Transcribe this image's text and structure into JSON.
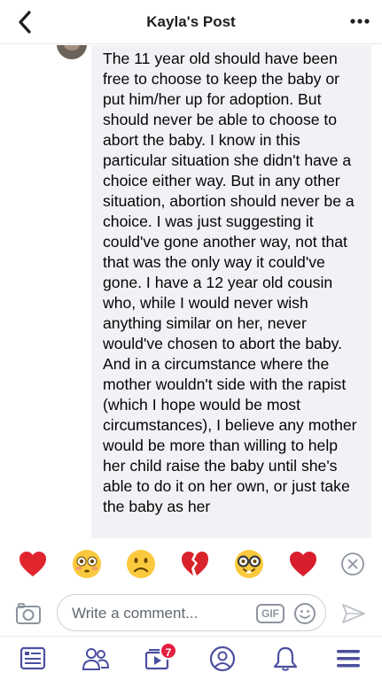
{
  "header": {
    "title": "Kayla's Post",
    "back_icon": "chevron-left-icon",
    "more_icon": "more-dots-icon"
  },
  "comment": {
    "text": "The 11 year old should have been free to choose to keep the baby or put him/her up for adoption. But should never be able to choose to abort the baby. I know in this particular situation she didn't have a choice either way. But in any other situation, abortion should never be a choice. I was just suggesting it could've gone another way, not that that was the only way it could've gone. I have a 12 year old cousin who, while I would never wish anything similar on her, never would've chosen to abort the baby. And in  a circumstance where the mother wouldn't side with the rapist (which I hope would be most circumstances), I believe any mother would be more than willing to help her child raise the baby until she's able to do it on her own, or just take the baby as her"
  },
  "reactions": [
    {
      "name": "red-heart",
      "icon": "red-heart-icon"
    },
    {
      "name": "flushed-face",
      "icon": "flushed-face-icon"
    },
    {
      "name": "frowning-face",
      "icon": "frowning-face-icon"
    },
    {
      "name": "broken-heart",
      "icon": "broken-heart-icon"
    },
    {
      "name": "nerd-face",
      "icon": "nerd-face-icon"
    },
    {
      "name": "heart",
      "icon": "heart-icon"
    }
  ],
  "composer": {
    "placeholder": "Write a comment...",
    "gif_label": "GIF"
  },
  "nav": {
    "watch_badge": "7"
  },
  "colors": {
    "accent": "#4b4f9e",
    "bubble": "#f0f2f5",
    "badge": "#e41e3f",
    "heart": "#e0252f"
  }
}
